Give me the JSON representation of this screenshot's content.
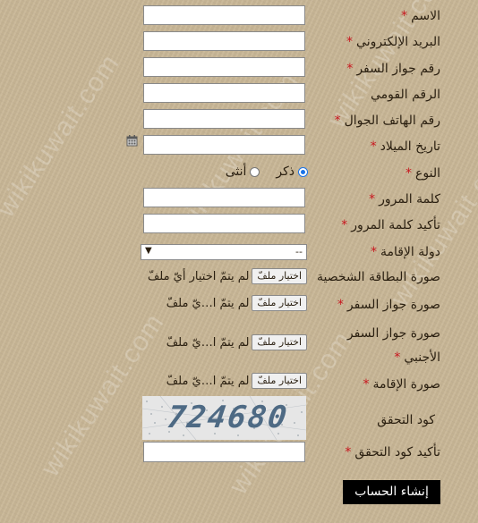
{
  "form": {
    "name_label": "الاسم",
    "email_label": "البريد الإلكتروني",
    "passport_label": "رقم جواز السفر",
    "national_id_label": "الرقم القومي",
    "mobile_label": "رقم الهاتف الجوال",
    "dob_label": "تاريخ الميلاد",
    "gender_label": "النوع",
    "gender_male": "ذكر",
    "gender_female": "أنثى",
    "password_label": "كلمة المرور",
    "confirm_password_label": "تأكيد كلمة المرور",
    "residence_country_label": "دولة الإقامة",
    "residence_country_value": "--",
    "id_card_image_label": "صورة البطاقة الشخصية",
    "passport_image_label": "صورة جواز السفر",
    "foreign_passport_image_label_1": "صورة جواز السفر",
    "foreign_passport_image_label_2": "الأجنبي",
    "residence_image_label": "صورة الإقامة",
    "captcha_label": "كود التحقق",
    "captcha_text": "724680",
    "confirm_captcha_label": "تأكيد كود التحقق",
    "required_mark": "*",
    "file_button": "اختيار ملفّ",
    "file_status_full": "لم يتمّ اختيار أيّ ملفّ",
    "file_status_short": "لم يتمّ ا…يّ ملفّ",
    "submit_label": "إنشاء الحساب"
  },
  "watermark": "wikikuwait.com",
  "colors": {
    "background": "#c8b696",
    "required": "#c8161e",
    "submit_bg": "#000000",
    "captcha_text": "#4e6a84"
  }
}
